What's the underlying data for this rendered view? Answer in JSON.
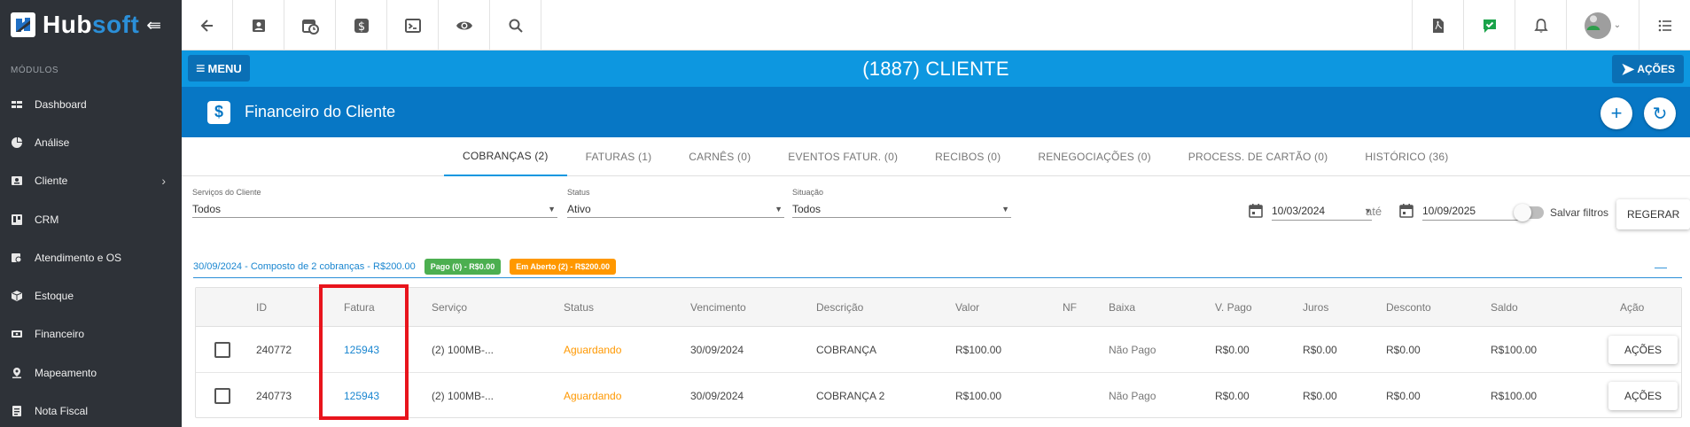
{
  "sidebar": {
    "brand_main": "Hub",
    "brand_accent": "soft",
    "modules_label": "MÓDULOS",
    "items": [
      {
        "label": "Dashboard",
        "icon": "dashboard-icon"
      },
      {
        "label": "Análise",
        "icon": "pie-chart-icon"
      },
      {
        "label": "Cliente",
        "icon": "contact-card-icon",
        "has_children": true
      },
      {
        "label": "CRM",
        "icon": "board-icon"
      },
      {
        "label": "Atendimento e OS",
        "icon": "calendar-clock-icon"
      },
      {
        "label": "Estoque",
        "icon": "box-icon"
      },
      {
        "label": "Financeiro",
        "icon": "money-icon"
      },
      {
        "label": "Mapeamento",
        "icon": "map-pin-icon"
      },
      {
        "label": "Nota Fiscal",
        "icon": "receipt-icon"
      }
    ]
  },
  "topbar": {
    "left_icons": [
      "back-arrow-icon",
      "contact-card-icon",
      "calendar-clock-icon",
      "dollar-icon",
      "terminal-icon",
      "eye-icon",
      "search-icon"
    ],
    "right_icons": [
      "pdf-icon",
      "check-chat-icon",
      "bell-icon",
      "avatar",
      "list-icon"
    ]
  },
  "titlebar": {
    "menu_label": "MENU",
    "title": "(1887) CLIENTE",
    "actions_label": "AÇÕES"
  },
  "section": {
    "icon_glyph": "$",
    "title": "Financeiro do Cliente"
  },
  "tabs": [
    {
      "label": "COBRANÇAS (2)",
      "active": true
    },
    {
      "label": "FATURAS (1)"
    },
    {
      "label": "CARNÊS (0)"
    },
    {
      "label": "EVENTOS FATUR. (0)"
    },
    {
      "label": "RECIBOS (0)"
    },
    {
      "label": "RENEGOCIAÇÕES (0)"
    },
    {
      "label": "PROCESS. DE CARTÃO (0)"
    },
    {
      "label": "HISTÓRICO (36)"
    }
  ],
  "filters": {
    "services": {
      "label": "Serviços do Cliente",
      "value": "Todos"
    },
    "status": {
      "label": "Status",
      "value": "Ativo"
    },
    "situation": {
      "label": "Situação",
      "value": "Todos"
    },
    "date_from": "10/03/2024",
    "date_separator": "até",
    "date_to": "10/09/2025",
    "save_filters_label": "Salvar filtros",
    "regenerate_label": "REGERAR"
  },
  "group": {
    "title": "30/09/2024 - Composto de 2 cobranças - R$200.00",
    "paid_badge": "Pago (0) - R$0.00",
    "open_badge": "Em Aberto (2) - R$200.00",
    "collapse_glyph": "—"
  },
  "table": {
    "headers": {
      "id": "ID",
      "invoice": "Fatura",
      "service": "Serviço",
      "status": "Status",
      "due": "Vencimento",
      "description": "Descrição",
      "value": "Valor",
      "nf": "NF",
      "settlement": "Baixa",
      "paid": "V. Pago",
      "interest": "Juros",
      "discount": "Desconto",
      "balance": "Saldo",
      "action": "Ação"
    },
    "rows": [
      {
        "id": "240772",
        "invoice": "125943",
        "service": "(2) 100MB-...",
        "status": "Aguardando",
        "due": "30/09/2024",
        "description": "COBRANÇA",
        "value": "R$100.00",
        "nf": "",
        "settlement": "Não Pago",
        "paid": "R$0.00",
        "interest": "R$0.00",
        "discount": "R$0.00",
        "balance": "R$100.00",
        "action": "AÇÕES"
      },
      {
        "id": "240773",
        "invoice": "125943",
        "service": "(2) 100MB-...",
        "status": "Aguardando",
        "due": "30/09/2024",
        "description": "COBRANÇA 2",
        "value": "R$100.00",
        "nf": "",
        "settlement": "Não Pago",
        "paid": "R$0.00",
        "interest": "R$0.00",
        "discount": "R$0.00",
        "balance": "R$100.00",
        "action": "AÇÕES"
      }
    ]
  },
  "colors": {
    "sidebar_bg": "#2e3238",
    "titlebar_bg": "#0d97e0",
    "section_bg": "#0777c5",
    "link": "#1a86d0",
    "status_waiting": "#ff9800",
    "badge_paid": "#4caf50",
    "badge_open": "#ff9800",
    "highlight": "#e8141c"
  }
}
